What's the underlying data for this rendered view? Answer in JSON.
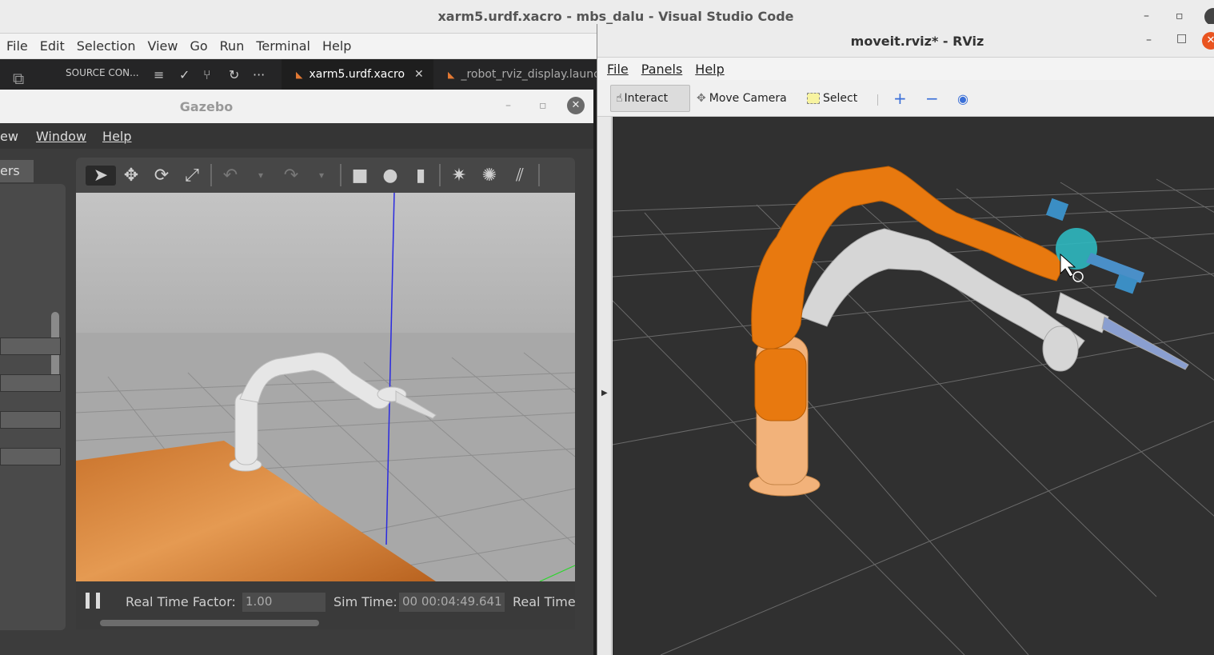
{
  "vscode": {
    "title": "xarm5.urdf.xacro - mbs_dalu - Visual Studio Code",
    "menu": [
      "File",
      "Edit",
      "Selection",
      "View",
      "Go",
      "Run",
      "Terminal",
      "Help"
    ],
    "source_control_label": "SOURCE CON...",
    "tabs": [
      {
        "label": "xarm5.urdf.xacro",
        "active": true
      },
      {
        "label": "_robot_rviz_display.launch",
        "active": false
      }
    ]
  },
  "gazebo": {
    "title": "Gazebo",
    "menu": [
      "ew",
      "Window",
      "Help"
    ],
    "left_tab": "ers",
    "status": {
      "real_time_factor_label": "Real Time Factor:",
      "real_time_factor_value": "1.00",
      "sim_time_label": "Sim Time:",
      "sim_time_value": "00 00:04:49.641",
      "real_time_label": "Real Time"
    }
  },
  "rviz": {
    "title": "moveit.rviz* - RViz",
    "menu": [
      "File",
      "Panels",
      "Help"
    ],
    "toolbar": {
      "interact": "Interact",
      "move_camera": "Move Camera",
      "select": "Select"
    }
  },
  "colors": {
    "orange_arm": "#e8790f",
    "peach_arm": "#f2b27a",
    "white_arm": "#d9d9d9",
    "teal_marker": "#2fb8c0",
    "rviz_bg": "#303030",
    "close_button": "#e95420"
  }
}
